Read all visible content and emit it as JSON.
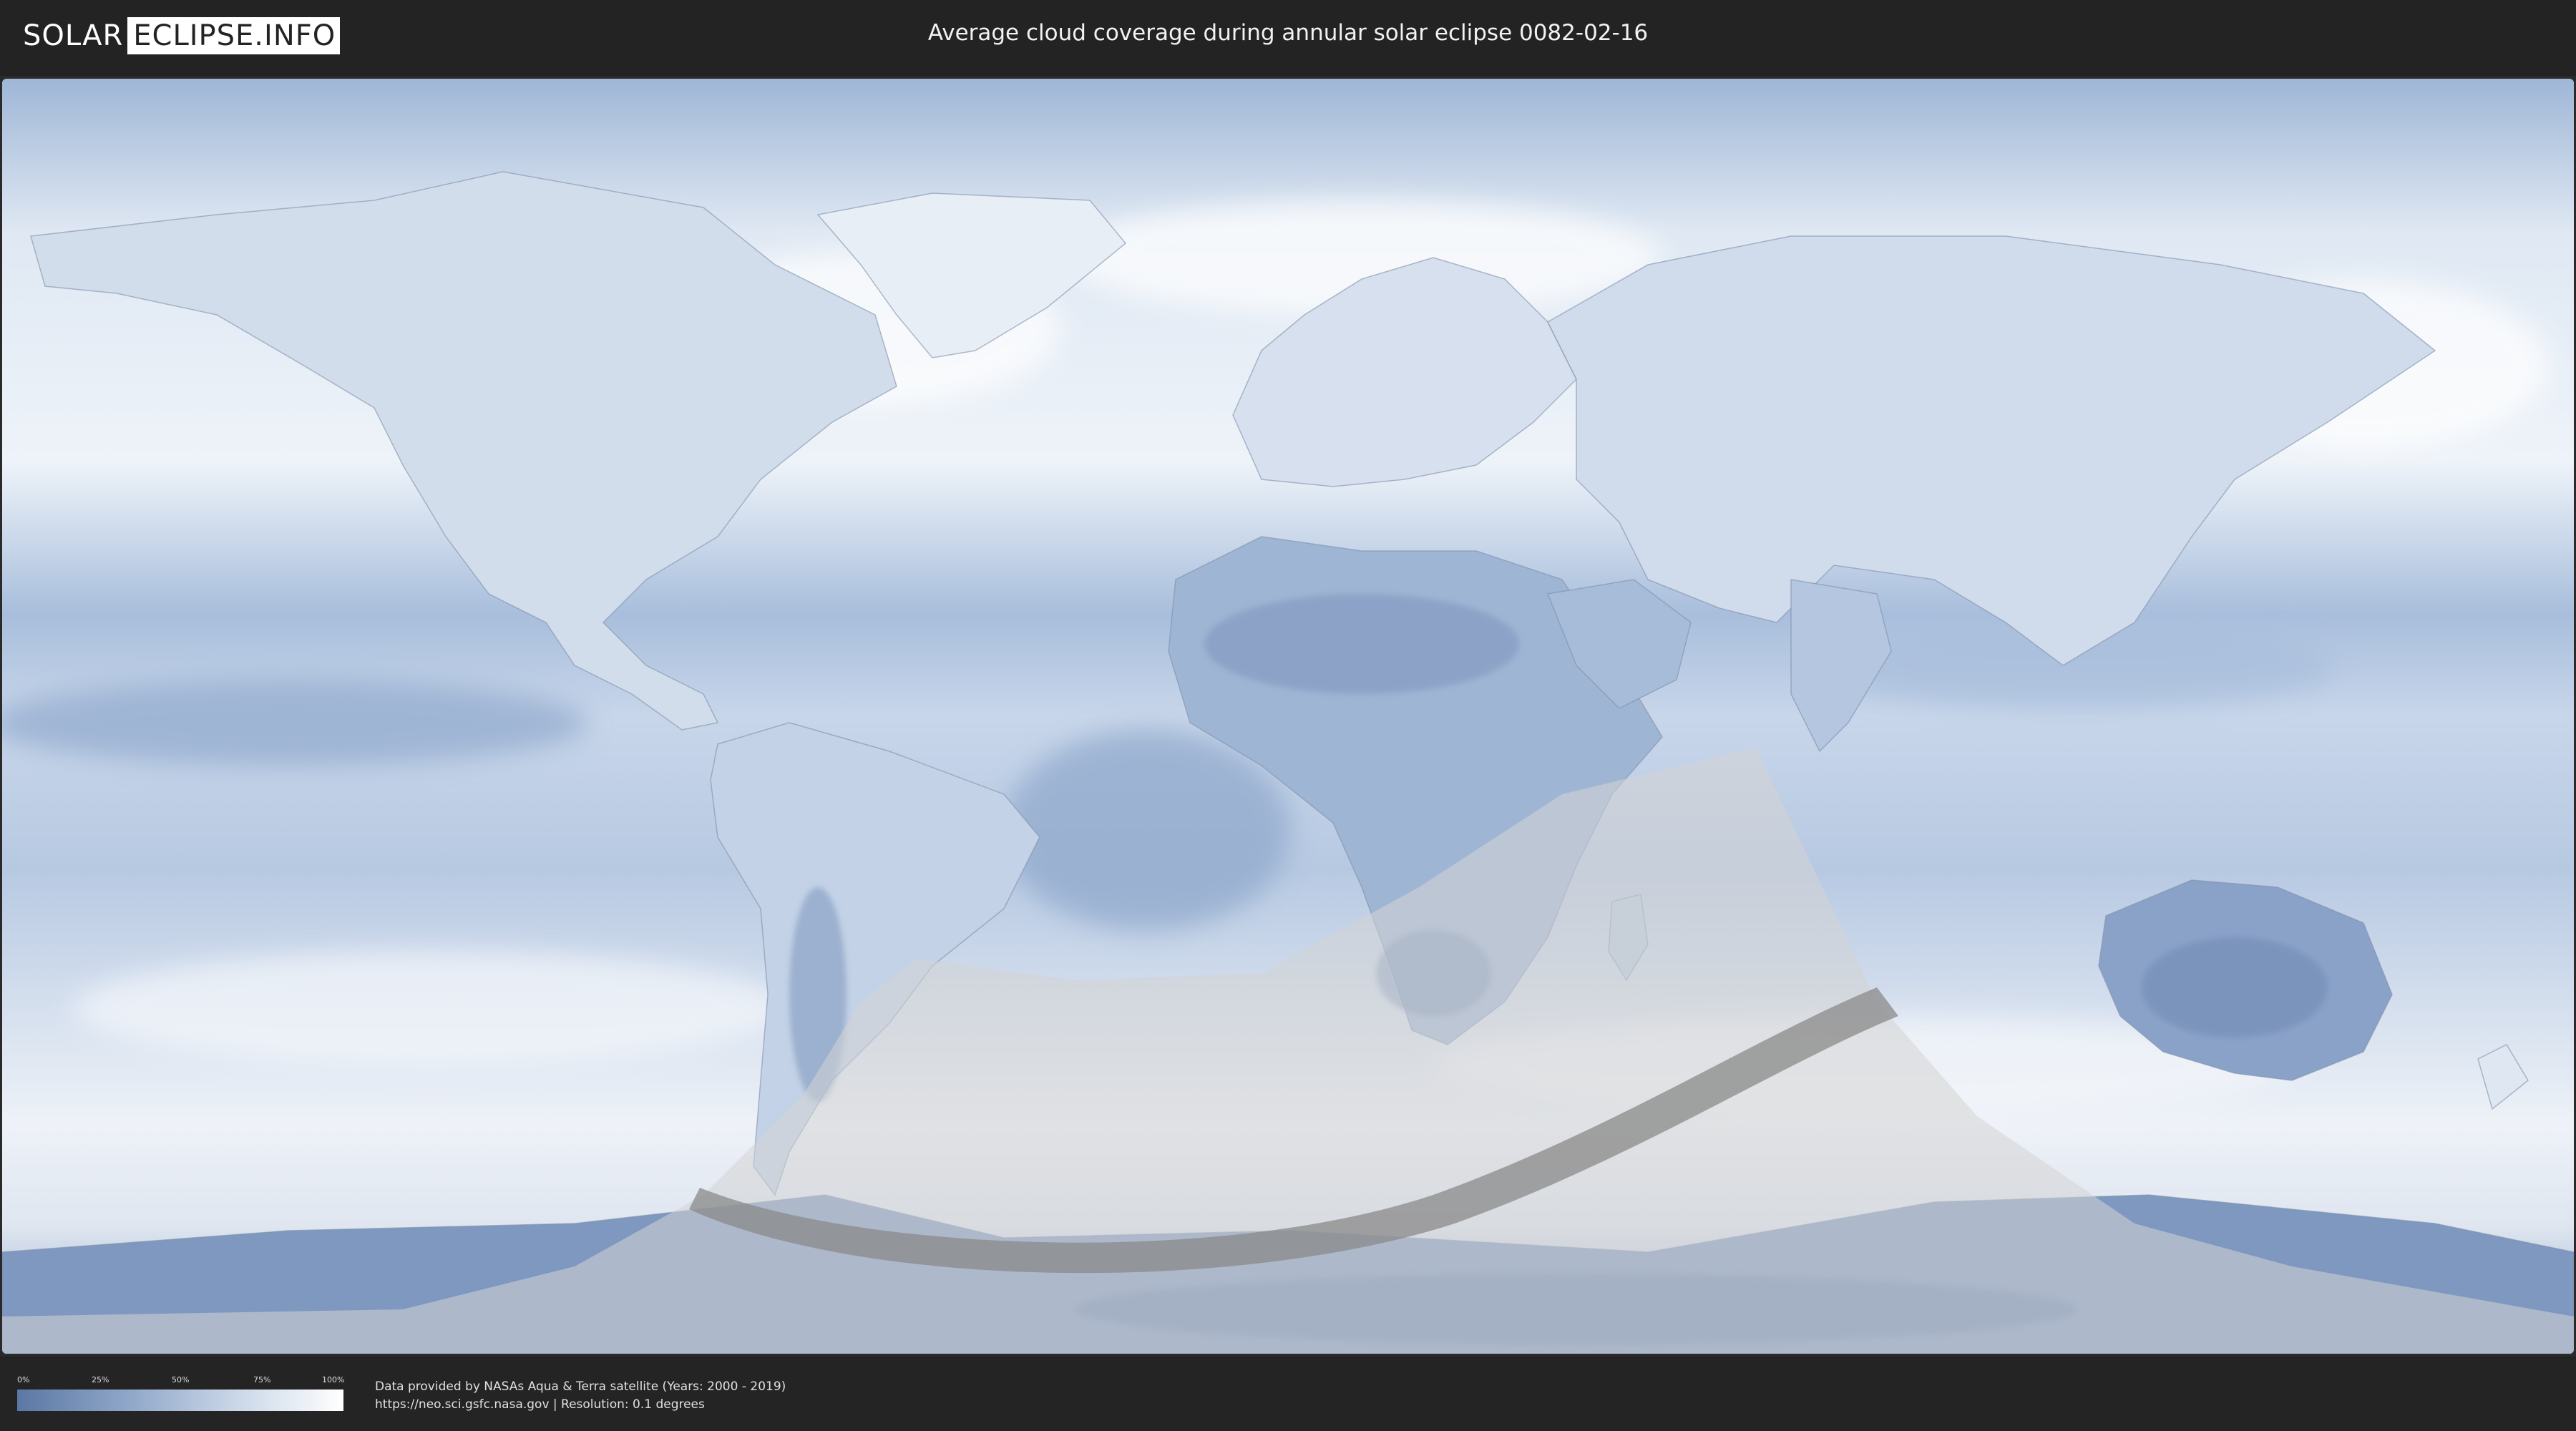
{
  "header": {
    "logo_left": "SOLAR",
    "logo_right": "ECLIPSE.INFO",
    "title": "Average cloud coverage during annular solar eclipse 0082-02-16"
  },
  "map": {
    "type": "cloud coverage world map",
    "projection": "equirectangular",
    "layers": [
      "average cloud coverage",
      "country borders",
      "eclipse visibility region",
      "annularity path"
    ],
    "colors": {
      "clear_sky": "#5b77a4",
      "full_cloud": "#ffffff",
      "visibility_overlay": "#d9d9d9",
      "annular_path": "#8a8a8a"
    }
  },
  "legend": {
    "ticks": [
      "0%",
      "25%",
      "50%",
      "75%",
      "100%"
    ]
  },
  "credits": {
    "line1": "Data provided by NASAs Aqua & Terra satellite (Years: 2000 - 2019)",
    "line2": "https://neo.sci.gsfc.nasa.gov | Resolution: 0.1 degrees"
  }
}
